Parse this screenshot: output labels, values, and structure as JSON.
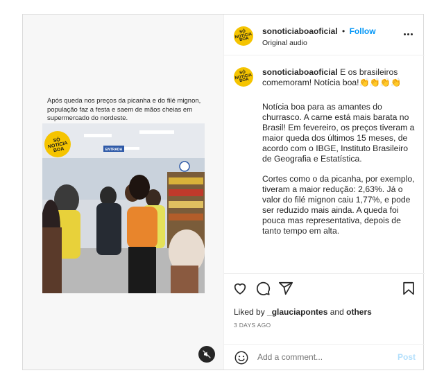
{
  "media": {
    "headline": "Após queda nos preços da picanha e do filé mignon, população faz a festa e saem de mãos cheias em supermercado do nordeste.",
    "logo_text": "SÓ NOTÍCIA BOA",
    "sign_text": "ENTRADA",
    "mute_icon": "speaker-muted-icon"
  },
  "header": {
    "username": "sonoticiaboaoficial",
    "separator": "•",
    "follow_label": "Follow",
    "subtitle": "Original audio",
    "avatar_text": "SÓ NOTÍCIA BOA"
  },
  "caption": {
    "username": "sonoticiaboaoficial",
    "lead": "E os brasileiros comemoram! Notícia boa!👏👏👏👏",
    "paragraph1": "Notícia boa para as amantes do churrasco. A carne está mais barata no Brasil! Em fevereiro, os preços tiveram a maior queda dos últimos 15 meses, de acordo com o IBGE, Instituto Brasileiro de Geografia e Estatística.",
    "paragraph2": "Cortes como o da picanha, por exemplo, tiveram a maior redução: 2,63%. Já o valor do filé mignon caiu 1,77%, e pode ser reduzido mais ainda. A queda foi pouca mas representativa, depois de tanto tempo em alta."
  },
  "actions": {
    "icons": [
      "heart-icon",
      "comment-icon",
      "share-icon",
      "bookmark-icon"
    ]
  },
  "likes": {
    "prefix": "Liked by",
    "user": "_glauciapontes",
    "conjunction": "and",
    "others": "others"
  },
  "time_ago": "3 DAYS AGO",
  "comment": {
    "placeholder": "Add a comment...",
    "post_label": "Post"
  },
  "colors": {
    "accent": "#0095f6",
    "brand_yellow": "#f5c400",
    "post_disabled": "#b2dffc",
    "muted_text": "#737373"
  }
}
